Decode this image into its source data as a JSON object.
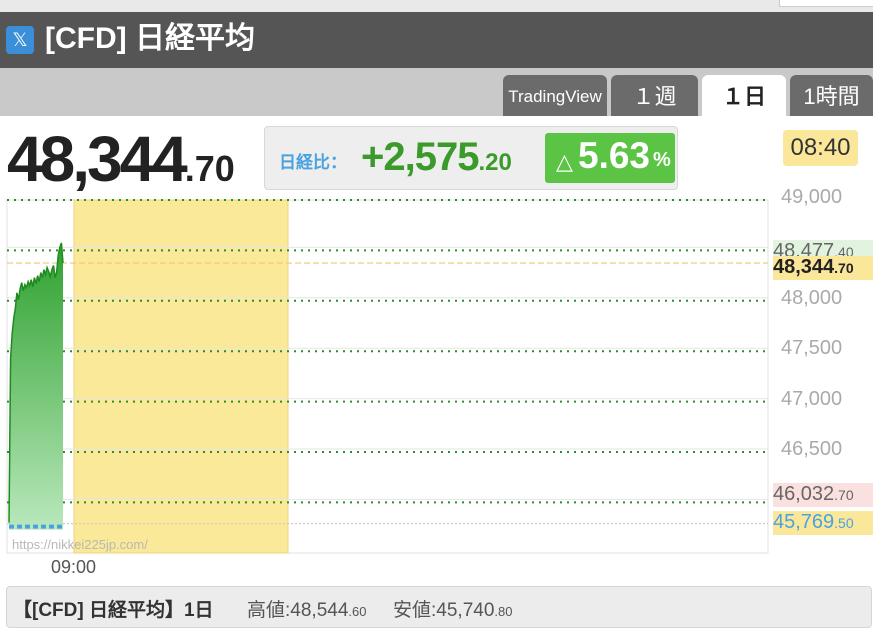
{
  "header": {
    "icon": "x-logo-icon",
    "title": "[CFD] 日経平均"
  },
  "tabs": [
    {
      "label": "TradingView",
      "active": false
    },
    {
      "label": "１週",
      "active": false
    },
    {
      "label": "１日",
      "active": true
    },
    {
      "label": "1時間",
      "active": false
    }
  ],
  "price": {
    "main": "48,344",
    "decimal": ".70"
  },
  "change": {
    "label": "日経比：",
    "value_main": "+2,575",
    "value_decimal": ".20",
    "pct_arrow": "△",
    "pct_value": "5.63",
    "pct_unit": "%"
  },
  "time": "08:40",
  "colors": {
    "accent_green": "#3a9a2a",
    "pct_bg": "#5cc445",
    "highlight_yellow": "#f9e998",
    "label_blue": "#4aa3df"
  },
  "chart_data": {
    "type": "area",
    "title": "",
    "xlabel": "",
    "ylabel": "",
    "ylim": [
      45700,
      49000
    ],
    "x_tick_labels": [
      "09:00"
    ],
    "y_tick_labels": [
      "49,000",
      "48,000",
      "47,500",
      "47,000",
      "46,500"
    ],
    "y_tick_values": [
      49000,
      48000,
      47500,
      47000,
      46500
    ],
    "series": [
      {
        "values": [
          45769.5,
          47400,
          47650,
          47800,
          47900,
          48050,
          47980,
          48090,
          48150,
          48070,
          48130,
          48100,
          48160,
          48120,
          48180,
          48110,
          48200,
          48140,
          48220,
          48160,
          48250,
          48200,
          48280,
          48230,
          48300,
          48260,
          48210,
          48280,
          48320,
          48200,
          48250,
          48420,
          48500,
          48544.6,
          48344.7
        ]
      }
    ],
    "reference_lines": [
      {
        "value": 48477.4,
        "label_main": "48,477",
        "label_decimal": ".40"
      },
      {
        "value": 48344.7,
        "label_main": "48,344",
        "label_decimal": ".70"
      },
      {
        "value": 46032.7,
        "label_main": "46,032",
        "label_decimal": ".70"
      },
      {
        "value": 45769.5,
        "label_main": "45,769",
        "label_decimal": ".50"
      }
    ],
    "highlight_band": true,
    "grid": true,
    "watermark": "https://nikkei225jp.com/"
  },
  "footer": {
    "title": "【[CFD] 日経平均】1日",
    "high_label": "高値:",
    "high_main": "48,544",
    "high_decimal": ".60",
    "low_label": "安値:",
    "low_main": "45,740",
    "low_decimal": ".80"
  }
}
